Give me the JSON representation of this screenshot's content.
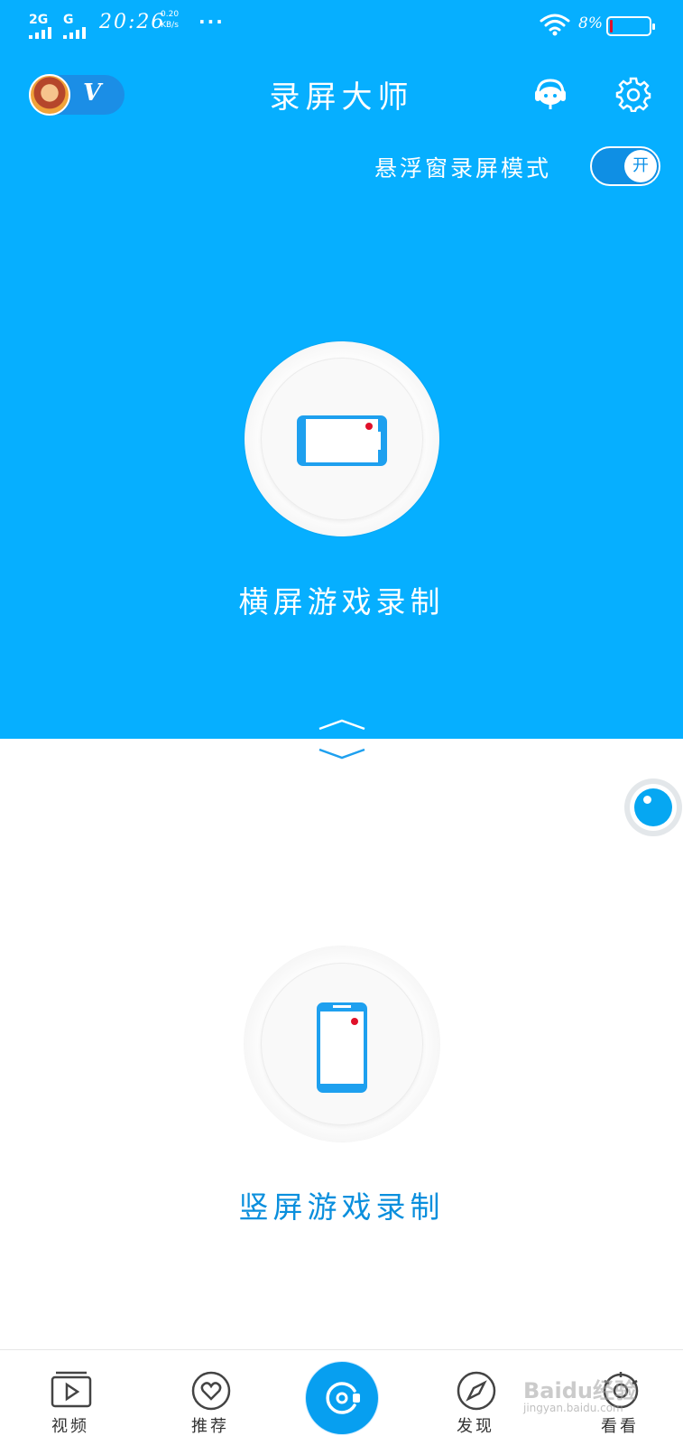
{
  "status_bar": {
    "network1": "2G",
    "network2": "G",
    "time": "20:26",
    "speed_value": "0.20",
    "speed_unit": "KB/s",
    "more": "···",
    "battery_text": "8%",
    "battery_level": 0.08
  },
  "header": {
    "vip_badge": "V",
    "title": "录屏大师"
  },
  "float_mode": {
    "label": "悬浮窗录屏模式",
    "toggle_text": "开",
    "enabled": true
  },
  "landscape": {
    "label": "横屏游戏录制"
  },
  "portrait": {
    "label": "竖屏游戏录制"
  },
  "nav": {
    "items": [
      {
        "label": "视频",
        "icon": "video-play-icon"
      },
      {
        "label": "推荐",
        "icon": "heart-icon"
      },
      {
        "label": "",
        "icon": "record-icon"
      },
      {
        "label": "发现",
        "icon": "compass-icon"
      },
      {
        "label": "看看",
        "icon": "lens-icon"
      }
    ]
  },
  "watermark": {
    "text": "Baidu经验",
    "sub": "jingyan.baidu.com"
  },
  "colors": {
    "primary": "#06afff",
    "accent_red": "#e0102a",
    "label_blue": "#0a8fdd"
  }
}
